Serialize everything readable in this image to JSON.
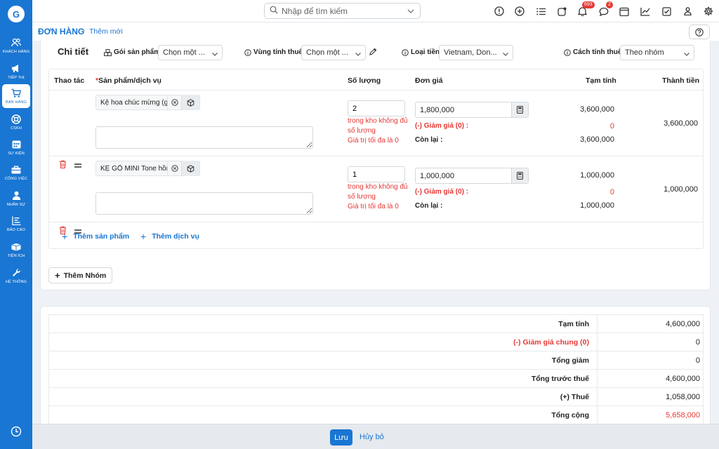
{
  "sidebar": {
    "logo": "G",
    "items": [
      {
        "label": "KHÁCH HÀNG",
        "icon": "users-icon"
      },
      {
        "label": "TIẾP THỊ",
        "icon": "megaphone-icon"
      },
      {
        "label": "BÁN HÀNG",
        "icon": "cart-icon",
        "active": true
      },
      {
        "label": "CSKH",
        "icon": "support-icon"
      },
      {
        "label": "SỰ KIỆN",
        "icon": "calendar-icon"
      },
      {
        "label": "CÔNG VIỆC",
        "icon": "briefcase-icon"
      },
      {
        "label": "NHÂN SỰ",
        "icon": "person-icon"
      },
      {
        "label": "BÁO CÁO",
        "icon": "report-icon"
      },
      {
        "label": "TIỆN ÍCH",
        "icon": "box-icon"
      },
      {
        "label": "HỆ THỐNG",
        "icon": "wrench-icon"
      }
    ]
  },
  "topbar": {
    "search_placeholder": "Nhập để tìm kiếm",
    "notifications_badge": "693",
    "messages_badge": "2"
  },
  "breadcrumb": {
    "main": "ĐƠN HÀNG",
    "separator": "›",
    "current": "Thêm mới"
  },
  "detail": {
    "title": "Chi tiết",
    "product_pack_label": "Gói sản phẩm",
    "product_pack_value": "Chọn một ...",
    "tax_zone_label": "Vùng tính thuế",
    "tax_zone_value": "Chọn một ...",
    "currency_label": "Loại tiền",
    "currency_value": "Vietnam, Don...",
    "tax_method_label": "Cách tính thuế",
    "tax_method_value": "Theo nhóm"
  },
  "table": {
    "headers": {
      "action": "Thao tác",
      "required_mark": "*",
      "product": "Sản phẩm/dịch vụ",
      "quantity": "Số lượng",
      "unit_price": "Đơn giá",
      "subtotal": "Tạm tính",
      "total": "Thành tiền"
    },
    "rows": [
      {
        "product": "Kệ hoa chúc mừng (gỗ",
        "quantity": "2",
        "warn_stock": "trong kho không đủ số lượng",
        "warn_max": "Giá trị tối đa là 0",
        "unit_price": "1,800,000",
        "discount_label": "(-) Giảm giá (0) :",
        "remaining_label": "Còn lại :",
        "subtotal": "3,600,000",
        "discount": "0",
        "remaining": "3,600,000",
        "total": "3,600,000"
      },
      {
        "product": "KỆ GỖ MINI Tone hồng",
        "quantity": "1",
        "warn_stock": "trong kho không đủ số lượng",
        "warn_max": "Giá trị tối đa là 0",
        "unit_price": "1,000,000",
        "discount_label": "(-) Giảm giá (0) :",
        "remaining_label": "Còn lại :",
        "subtotal": "1,000,000",
        "discount": "0",
        "remaining": "1,000,000",
        "total": "1,000,000"
      }
    ],
    "add_product": "Thêm sản phẩm",
    "add_service": "Thêm dịch vụ"
  },
  "add_group": "Thêm Nhóm",
  "summary": {
    "subtotal_label": "Tạm tính",
    "subtotal_value": "4,600,000",
    "discount_prefix": "(-)",
    "discount_label": "Giảm giá chung (0)",
    "discount_value": "0",
    "total_discount_label": "Tổng giảm",
    "total_discount_value": "0",
    "pre_tax_label": "Tổng trước thuế",
    "pre_tax_value": "4,600,000",
    "tax_label": "(+) Thuế",
    "tax_value": "1,058,000",
    "grand_total_label": "Tổng cộng",
    "grand_total_value": "5,658,000"
  },
  "footer": {
    "save": "Lưu",
    "cancel": "Hủy bỏ"
  }
}
